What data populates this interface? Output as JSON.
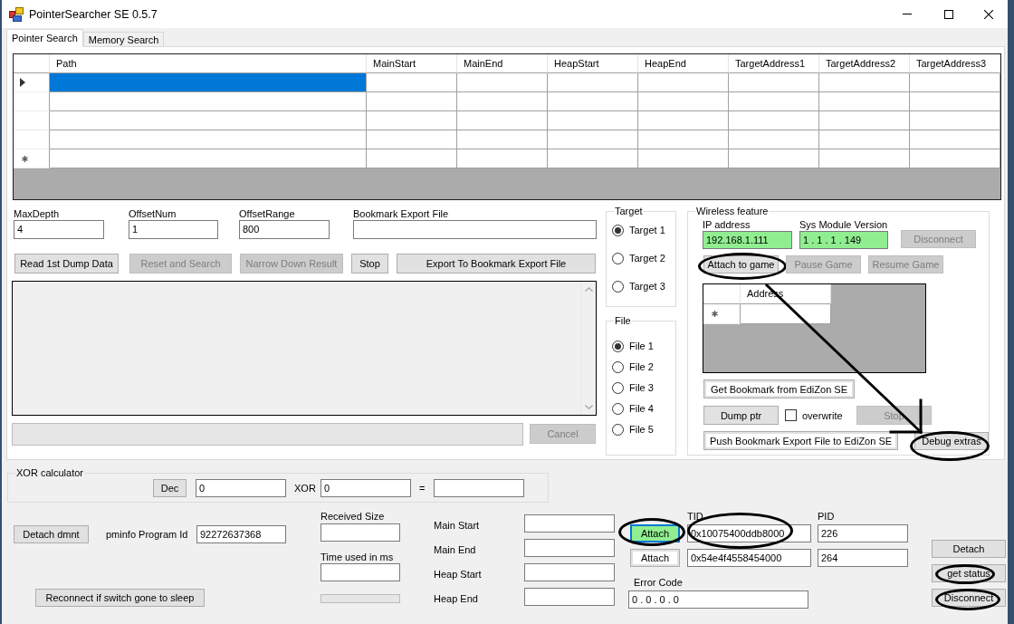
{
  "window": {
    "title": "PointerSearcher SE 0.5.7"
  },
  "tabs": [
    {
      "label": "Pointer Search",
      "selected": true
    },
    {
      "label": "Memory Search",
      "selected": false
    }
  ],
  "results_table": {
    "columns": [
      "Path",
      "MainStart",
      "MainEnd",
      "HeapStart",
      "HeapEnd",
      "TargetAddress1",
      "TargetAddress2",
      "TargetAddress3"
    ],
    "rows": [
      {
        "kind": "data",
        "current": true,
        "selected": true
      },
      {
        "kind": "data",
        "current": false,
        "selected": false
      },
      {
        "kind": "data",
        "current": false,
        "selected": false
      },
      {
        "kind": "data",
        "current": false,
        "selected": false
      },
      {
        "kind": "new",
        "current": false,
        "selected": false
      }
    ]
  },
  "search_fields": [
    {
      "label": "MaxDepth",
      "value": "4"
    },
    {
      "label": "OffsetNum",
      "value": "1"
    },
    {
      "label": "OffsetRange",
      "value": "800"
    },
    {
      "label": "Bookmark Export File"
    }
  ],
  "search_buttons": [
    {
      "label": "Read 1st Dump Data",
      "disabled": false
    },
    {
      "label": "Reset and Search",
      "disabled": true
    },
    {
      "label": "Narrow Down Result",
      "disabled": true
    },
    {
      "label": "Stop",
      "disabled": false
    },
    {
      "label": "Export To Bookmark Export File",
      "disabled": false
    }
  ],
  "search_progress": {
    "level": 0
  },
  "cancel_button": {
    "label": "Cancel",
    "disabled": true
  },
  "target_group": {
    "title": "Target",
    "options": [
      {
        "label": "Target 1",
        "selected": true
      },
      {
        "label": "Target 2",
        "selected": false
      },
      {
        "label": "Target 3",
        "selected": false
      }
    ]
  },
  "file_group": {
    "title": "File",
    "options": [
      {
        "label": "File 1",
        "selected": true
      },
      {
        "label": "File 2",
        "selected": false
      },
      {
        "label": "File 3",
        "selected": false
      },
      {
        "label": "File 4",
        "selected": false
      },
      {
        "label": "File 5",
        "selected": false
      }
    ]
  },
  "wireless": {
    "title": "Wireless feature",
    "ip_address": {
      "label": "IP address",
      "value": "192.168.1.111",
      "highlighted": true
    },
    "sys_module_version": {
      "label": "Sys Module Version",
      "value": "1 . 1 . 1 . 149",
      "highlighted": true
    },
    "disconnect_button": {
      "label": "Disconnect",
      "disabled": true
    },
    "game_buttons": [
      {
        "label": "Attach to game",
        "disabled": false,
        "circled": true
      },
      {
        "label": "Pause Game",
        "disabled": true,
        "circled": false
      },
      {
        "label": "Resume Game",
        "disabled": true,
        "circled": false
      }
    ],
    "address_table": {
      "columns": [
        "Address"
      ],
      "rows": [
        {
          "kind": "new"
        }
      ]
    },
    "get_bookmark_button": "Get Bookmark from EdiZon SE",
    "dump_ptr_button": "Dump ptr",
    "overwrite": {
      "label": "overwrite",
      "checked": false
    },
    "stop_button": {
      "label": "Stop",
      "disabled": true
    },
    "push_bookmark_button": "Push Bookmark Export File to EdiZon SE",
    "debug_extras_button": {
      "label": "Debug extras",
      "circled": true
    },
    "annotation_arrow": true
  },
  "xor_calculator": {
    "title": "XOR calculator",
    "mode_button": "Dec",
    "operand_a": "0",
    "operator": "XOR",
    "operand_b": "0",
    "equals": "="
  },
  "dmnt": {
    "detach_button": "Detach dmnt",
    "program_id_label": "pminfo Program Id",
    "program_id": "92272637368",
    "reconnect_button": "Reconnect if switch gone to sleep"
  },
  "transfer": {
    "received_size_label": "Received Size",
    "time_used_label": "Time used in ms",
    "progress": {
      "level": 0
    }
  },
  "memory_ranges": [
    {
      "label": "Main Start"
    },
    {
      "label": "Main End"
    },
    {
      "label": "Heap Start"
    },
    {
      "label": "Heap End"
    }
  ],
  "process": {
    "tid_label": "TID",
    "pid_label": "PID",
    "rows": [
      {
        "button": {
          "label": "Attach",
          "kind": "green",
          "circled": true
        },
        "tid": {
          "value": "0x10075400ddb8000",
          "circled": true
        },
        "pid": "226"
      },
      {
        "button": {
          "label": "Attach",
          "kind": "light",
          "circled": false
        },
        "tid": {
          "value": "0x54e4f4558454000",
          "circled": false
        },
        "pid": "264"
      }
    ],
    "error_code_label": "Error Code",
    "error_code": "0 . 0 . 0 . 0"
  },
  "connection_buttons": [
    {
      "label": "Detach",
      "circled": false
    },
    {
      "label": "get status",
      "circled": true
    },
    {
      "label": "Disconnect",
      "circled": true
    }
  ]
}
